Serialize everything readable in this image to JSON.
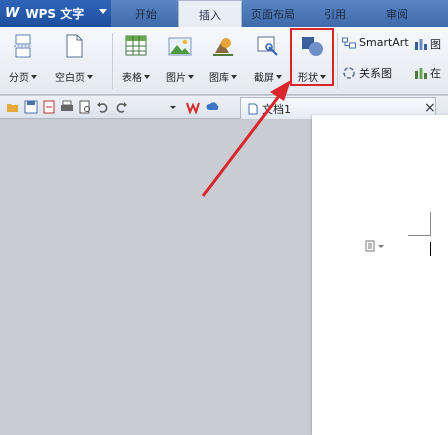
{
  "app": {
    "logo": "W",
    "title": "WPS 文字"
  },
  "tabs": [
    {
      "label": "开始",
      "active": false
    },
    {
      "label": "插入",
      "active": true
    },
    {
      "label": "页面布局",
      "active": false
    },
    {
      "label": "引用",
      "active": false
    },
    {
      "label": "审阅",
      "active": false
    }
  ],
  "ribbon": {
    "page_break": "分页",
    "blank_page": "空白页",
    "table": "表格",
    "picture": "图片",
    "gallery": "图库",
    "screenshot": "截屏",
    "shapes": "形状",
    "smartart": "SmartArt",
    "chart": "图",
    "relation_graph": "关系图",
    "online": "在"
  },
  "doc_tab": {
    "label": "文档1"
  },
  "close_label": "×",
  "colors": {
    "accent_blue": "#3f6aab",
    "highlight_red": "#d9262a",
    "page_bg": "#ffffff",
    "workspace_bg": "#c9ccd3"
  }
}
